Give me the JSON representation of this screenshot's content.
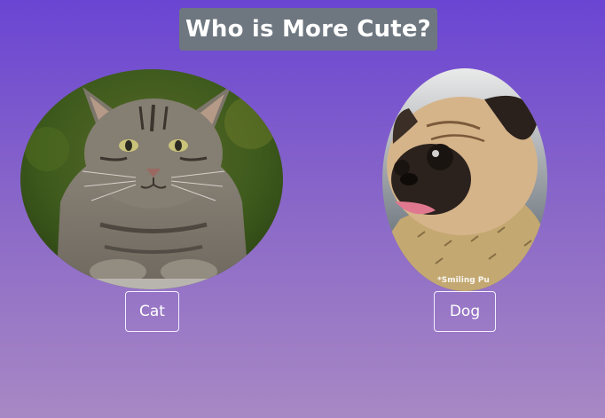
{
  "page": {
    "title": "Who is More Cute?"
  },
  "pets": {
    "cat": {
      "button_label": "Cat",
      "image_icon": "cat-photo"
    },
    "dog": {
      "button_label": "Dog",
      "image_icon": "dog-photo",
      "watermark": "*Smiling Pu"
    }
  },
  "colors": {
    "background_top": "#6a45d3",
    "background_bottom": "#a888c4",
    "title_background": "#6e7780",
    "text": "#ffffff"
  }
}
